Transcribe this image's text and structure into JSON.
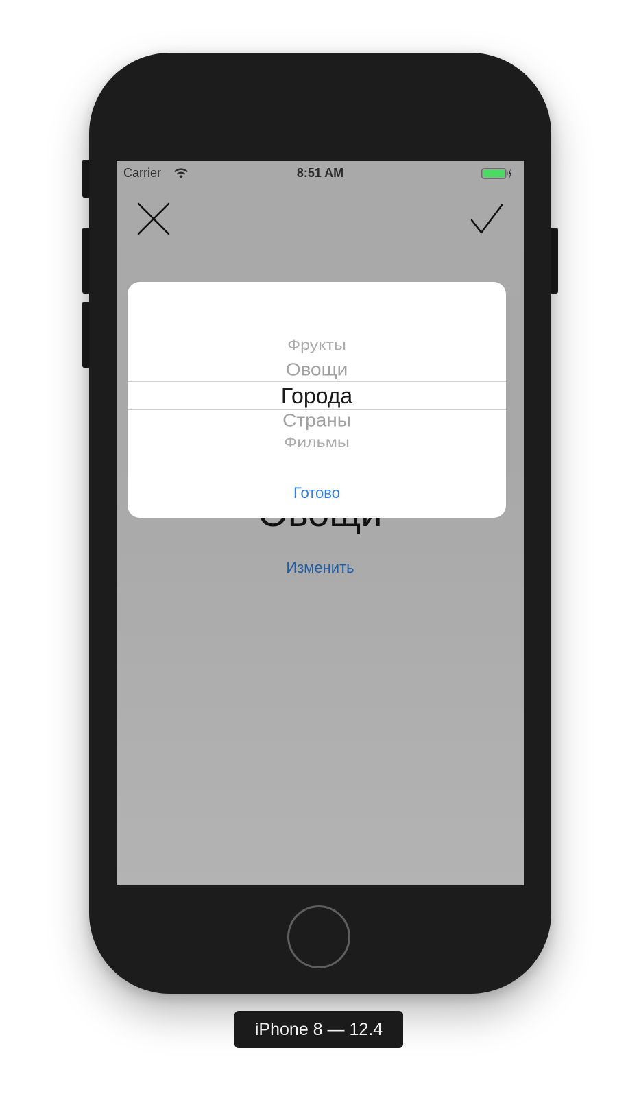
{
  "status_bar": {
    "carrier": "Carrier",
    "time": "8:51 AM",
    "wifi_icon": "wifi-icon",
    "battery_icon": "battery-charging-icon",
    "battery_color": "#4cd964"
  },
  "nav": {
    "close_icon": "close-icon",
    "confirm_icon": "checkmark-icon"
  },
  "main": {
    "current_value": "Овощи",
    "change_link": "Изменить"
  },
  "picker": {
    "options": [
      "Фрукты",
      "Овощи",
      "Города",
      "Страны",
      "Фильмы"
    ],
    "selected": "Города",
    "done_label": "Готово"
  },
  "device": {
    "label": "iPhone 8 — 12.4"
  },
  "colors": {
    "screen_dim": "#a9a9a9",
    "link_blue": "#2f7fe0",
    "frame": "#1c1c1c"
  }
}
